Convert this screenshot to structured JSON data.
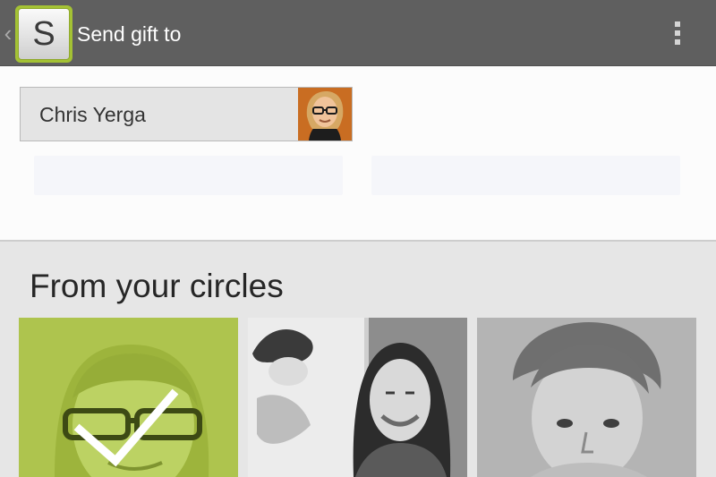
{
  "action_bar": {
    "title": "Send gift to",
    "app_icon_letter": "S",
    "back_icon": "chevron-left-icon",
    "overflow_icon": "overflow-menu-icon",
    "background_color": "#5f5f5f",
    "accent_color": "#a4c234"
  },
  "recipient": {
    "name": "Chris Yerga",
    "avatar": "person-avatar"
  },
  "circles": {
    "title": "From your circles",
    "people": [
      {
        "photo": "man-with-glasses-photo",
        "selected": true,
        "check_icon": "checkmark-icon"
      },
      {
        "photo": "woman-smiling-photo",
        "selected": false
      },
      {
        "photo": "young-man-photo",
        "selected": false
      }
    ]
  }
}
